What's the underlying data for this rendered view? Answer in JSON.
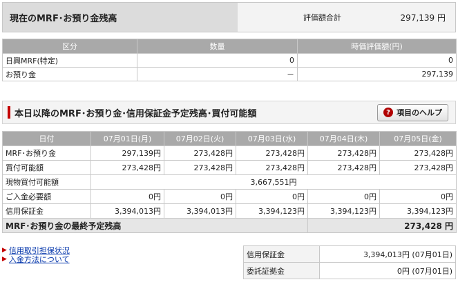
{
  "summary": {
    "title": "現在のMRF･お預り金残高",
    "eval_label": "評価額合計",
    "eval_value": "297,139 円"
  },
  "balance_table": {
    "headers": [
      "区分",
      "数量",
      "時価評価額(円)"
    ],
    "rows": [
      [
        "日興MRF(特定)",
        "0",
        "0"
      ],
      [
        "お預り金",
        "－",
        "297,139"
      ]
    ]
  },
  "section": {
    "title": "本日以降のMRF･お預り金･信用保証金予定残高･買付可能額",
    "help_label": "項目のヘルプ",
    "help_icon": "question-icon"
  },
  "schedule_table": {
    "headers": [
      "日付",
      "07月01日(月)",
      "07月02日(火)",
      "07月03日(水)",
      "07月04日(木)",
      "07月05日(金)"
    ],
    "rows": [
      [
        "MRF･お預り金",
        "297,139円",
        "273,428円",
        "273,428円",
        "273,428円",
        "273,428円"
      ],
      [
        "買付可能額",
        "273,428円",
        "273,428円",
        "273,428円",
        "273,428円",
        "273,428円"
      ]
    ],
    "spot_label": "現物買付可能額",
    "spot_value": "3,667,551円",
    "rows2": [
      [
        "ご入金必要額",
        "0円",
        "0円",
        "0円",
        "0円",
        "0円"
      ],
      [
        "信用保証金",
        "3,394,013円",
        "3,394,013円",
        "3,394,123円",
        "3,394,123円",
        "3,394,123円"
      ]
    ],
    "final_label": "MRF･お預り金の最終予定残高",
    "final_value": "273,428 円"
  },
  "links": {
    "link1": "信用取引担保状況",
    "link2": "入金方法について"
  },
  "margin_table": {
    "rows": [
      [
        "信用保証金",
        "3,394,013円 (07月01日)"
      ],
      [
        "委託証拠金",
        "0円 (07月01日)"
      ]
    ]
  }
}
